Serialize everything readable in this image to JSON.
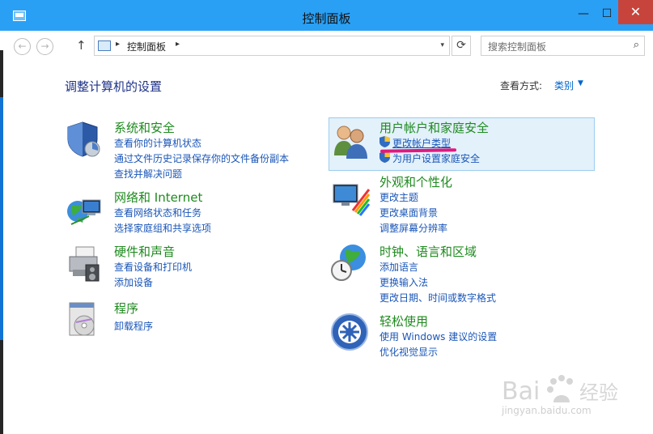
{
  "window": {
    "title": "控制面板",
    "minimize": "—",
    "maximize": "☐",
    "close": "✕"
  },
  "address_bar": {
    "back": "←",
    "forward": "→",
    "up": "↑",
    "crumb": "控制面板",
    "separator": "▸",
    "dropdown": "▾",
    "refresh": "⟳",
    "search_placeholder": "搜索控制面板",
    "search_icon": "⌕"
  },
  "main": {
    "heading": "调整计算机的设置",
    "view_by_label": "查看方式:",
    "view_by_value": "类别",
    "view_by_caret": "▼"
  },
  "categories_left": [
    {
      "icon": "shield-icon",
      "title": "系统和安全",
      "links": [
        "查看你的计算机状态",
        "通过文件历史记录保存你的文件备份副本",
        "查找并解决问题"
      ]
    },
    {
      "icon": "network-globe-icon",
      "title": "网络和 Internet",
      "links": [
        "查看网络状态和任务",
        "选择家庭组和共享选项"
      ]
    },
    {
      "icon": "printer-icon",
      "title": "硬件和声音",
      "links": [
        "查看设备和打印机",
        "添加设备"
      ]
    },
    {
      "icon": "programs-icon",
      "title": "程序",
      "links": [
        "卸载程序"
      ]
    }
  ],
  "categories_right": [
    {
      "icon": "users-icon",
      "title": "用户帐户和家庭安全",
      "links": [
        "更改帐户类型",
        "为用户设置家庭安全"
      ]
    },
    {
      "icon": "appearance-icon",
      "title": "外观和个性化",
      "links": [
        "更改主题",
        "更改桌面背景",
        "调整屏幕分辨率"
      ]
    },
    {
      "icon": "clock-globe-icon",
      "title": "时钟、语言和区域",
      "links": [
        "添加语言",
        "更换输入法",
        "更改日期、时间或数字格式"
      ]
    },
    {
      "icon": "ease-of-access-icon",
      "title": "轻松使用",
      "links": [
        "使用 Windows 建议的设置",
        "优化视觉显示"
      ]
    }
  ],
  "watermark": {
    "brand": "Bai",
    "brand2": "经验",
    "url": "jingyan.baidu.com"
  },
  "colors": {
    "titlebar": "#2aa0f5",
    "category_title": "#1e8a1e",
    "link": "#1a56b8",
    "heading": "#1e3287",
    "highlight": "#e3f1fb",
    "annotation": "#e0197e"
  }
}
